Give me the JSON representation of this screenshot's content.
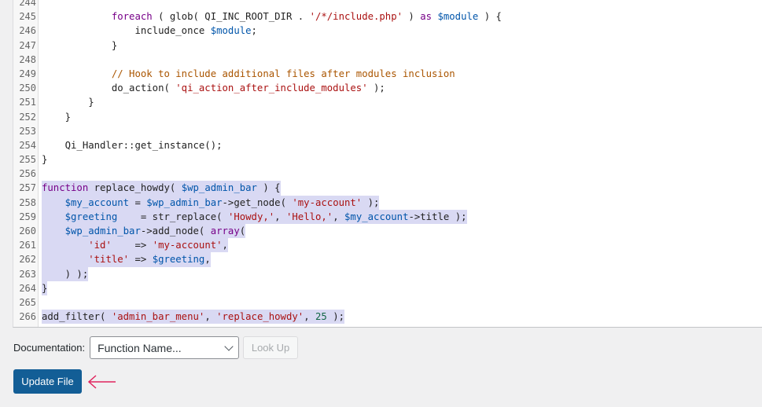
{
  "editor": {
    "lines": [
      {
        "n": "244",
        "sel": false,
        "tokens": []
      },
      {
        "n": "245",
        "sel": false,
        "tokens": [
          [
            "",
            "            "
          ],
          [
            "kw",
            "foreach"
          ],
          [
            "",
            " ( glob( QI_INC_ROOT_DIR . "
          ],
          [
            "str",
            "'/*/include.php'"
          ],
          [
            "",
            " ) "
          ],
          [
            "kw",
            "as"
          ],
          [
            "",
            " "
          ],
          [
            "var",
            "$module"
          ],
          [
            "",
            " ) {"
          ]
        ]
      },
      {
        "n": "246",
        "sel": false,
        "tokens": [
          [
            "",
            "                include_once "
          ],
          [
            "var",
            "$module"
          ],
          [
            "",
            ";"
          ]
        ]
      },
      {
        "n": "247",
        "sel": false,
        "tokens": [
          [
            "",
            "            }"
          ]
        ]
      },
      {
        "n": "248",
        "sel": false,
        "tokens": []
      },
      {
        "n": "249",
        "sel": false,
        "tokens": [
          [
            "",
            "            "
          ],
          [
            "cm",
            "// Hook to include additional files after modules inclusion"
          ]
        ]
      },
      {
        "n": "250",
        "sel": false,
        "tokens": [
          [
            "",
            "            do_action( "
          ],
          [
            "str",
            "'qi_action_after_include_modules'"
          ],
          [
            "",
            " );"
          ]
        ]
      },
      {
        "n": "251",
        "sel": false,
        "tokens": [
          [
            "",
            "        }"
          ]
        ]
      },
      {
        "n": "252",
        "sel": false,
        "tokens": [
          [
            "",
            "    }"
          ]
        ]
      },
      {
        "n": "253",
        "sel": false,
        "tokens": []
      },
      {
        "n": "254",
        "sel": false,
        "tokens": [
          [
            "",
            "    Qi_Handler::get_instance();"
          ]
        ]
      },
      {
        "n": "255",
        "sel": false,
        "tokens": [
          [
            "",
            "}"
          ]
        ]
      },
      {
        "n": "256",
        "sel": false,
        "tokens": []
      },
      {
        "n": "257",
        "sel": true,
        "tokens": [
          [
            "kw",
            "function"
          ],
          [
            "",
            " replace_howdy( "
          ],
          [
            "var",
            "$wp_admin_bar"
          ],
          [
            "",
            " ) {"
          ]
        ]
      },
      {
        "n": "258",
        "sel": true,
        "tokens": [
          [
            "",
            "    "
          ],
          [
            "var",
            "$my_account"
          ],
          [
            "",
            " = "
          ],
          [
            "var",
            "$wp_admin_bar"
          ],
          [
            "",
            "->get_node( "
          ],
          [
            "str",
            "'my-account'"
          ],
          [
            "",
            " );"
          ]
        ]
      },
      {
        "n": "259",
        "sel": true,
        "tokens": [
          [
            "",
            "    "
          ],
          [
            "var",
            "$greeting"
          ],
          [
            "",
            "    = str_replace( "
          ],
          [
            "str",
            "'Howdy,'"
          ],
          [
            "",
            ", "
          ],
          [
            "str",
            "'Hello,'"
          ],
          [
            "",
            ", "
          ],
          [
            "var",
            "$my_account"
          ],
          [
            "",
            "->title );"
          ]
        ]
      },
      {
        "n": "260",
        "sel": true,
        "tokens": [
          [
            "",
            "    "
          ],
          [
            "var",
            "$wp_admin_bar"
          ],
          [
            "",
            "->add_node( "
          ],
          [
            "kw",
            "array"
          ],
          [
            "",
            "("
          ]
        ]
      },
      {
        "n": "261",
        "sel": true,
        "tokens": [
          [
            "",
            "        "
          ],
          [
            "str",
            "'id'"
          ],
          [
            "",
            "    => "
          ],
          [
            "str",
            "'my-account'"
          ],
          [
            "",
            ","
          ]
        ]
      },
      {
        "n": "262",
        "sel": true,
        "tokens": [
          [
            "",
            "        "
          ],
          [
            "str",
            "'title'"
          ],
          [
            "",
            " => "
          ],
          [
            "var",
            "$greeting"
          ],
          [
            "",
            ","
          ]
        ]
      },
      {
        "n": "263",
        "sel": true,
        "tokens": [
          [
            "",
            "    ) );"
          ]
        ]
      },
      {
        "n": "264",
        "sel": true,
        "tokens": [
          [
            "",
            "}"
          ]
        ]
      },
      {
        "n": "265",
        "sel": false,
        "tokens": []
      },
      {
        "n": "266",
        "sel": true,
        "tokens": [
          [
            "",
            "add_filter( "
          ],
          [
            "str",
            "'admin_bar_menu'"
          ],
          [
            "",
            ", "
          ],
          [
            "str",
            "'replace_howdy'"
          ],
          [
            "",
            ", "
          ],
          [
            "num",
            "25"
          ],
          [
            "",
            " );"
          ]
        ]
      }
    ]
  },
  "documentation": {
    "label": "Documentation:",
    "select_value": "Function Name...",
    "lookup_label": "Look Up"
  },
  "update_button": "Update File",
  "colors": {
    "primary": "#135e96",
    "selection": "#d9d9f3",
    "annotation_arrow": "#e0245e"
  }
}
